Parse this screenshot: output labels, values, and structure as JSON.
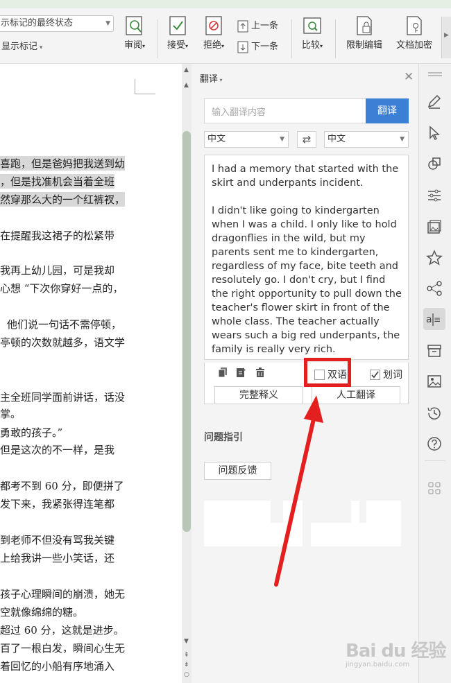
{
  "ribbon": {
    "markup_state": "示标记的最终状态",
    "show_markup": "显示标记",
    "review": "审阅",
    "accept": "接受",
    "reject": "拒绝",
    "prev": "上一条",
    "next": "下一条",
    "compare": "比较",
    "restrict_edit": "限制编辑",
    "doc_encrypt": "文档加密"
  },
  "document": {
    "lines": [
      {
        "text": "喜跑，但是爸妈把我送到幼",
        "highlight": true
      },
      {
        "text": "，但是找准机会当着全班",
        "highlight": true
      },
      {
        "text": "然穿那么大的一个红裤衩，",
        "highlight": true
      },
      {
        "text": "在提醒我这裙子的松紧带",
        "highlight": false
      },
      {
        "text": "我再上幼儿园，可是我却",
        "highlight": false
      },
      {
        "text": "心想 “下次你穿好一点的，",
        "highlight": false
      },
      {
        "text": "他们说一句话不需停顿，",
        "highlight": false
      },
      {
        "text": "亭顿的次数就越多，语文学",
        "highlight": false
      },
      {
        "text": "主全班同学面前讲话，话没",
        "highlight": false
      },
      {
        "text": "掌。",
        "highlight": false
      },
      {
        "text": "勇敢的孩子。”",
        "highlight": false
      },
      {
        "text": "但是这次的不一样，是我",
        "highlight": false
      },
      {
        "text": "都考不到 60 分，即便拼了",
        "highlight": false
      },
      {
        "text": "发下来，我紧张得连笔都",
        "highlight": false
      },
      {
        "text": "到老师不但没有骂我关键",
        "highlight": false
      },
      {
        "text": "上给我讲一些小笑话，还",
        "highlight": false
      },
      {
        "text": "孩子心理瞬间的崩溃，她无",
        "highlight": false
      },
      {
        "text": "空就像绵绵的糖。",
        "highlight": false
      },
      {
        "text": "超过 60 分，这就是进步。",
        "highlight": false
      },
      {
        "text": "百了一根白发，瞬间心生无",
        "highlight": false
      },
      {
        "text": "着回忆的小船有序地涌入",
        "highlight": false
      }
    ]
  },
  "panel": {
    "title": "翻译",
    "input_placeholder": "输入翻译内容",
    "translate_button": "翻译",
    "source_lang": "中文",
    "target_lang": "中文",
    "result_paragraphs": [
      "I had a memory that started with the skirt and underpants incident.",
      "I didn't like going to kindergarten when I was a child. I only like to hold dragonflies in the wild, but my parents sent me to kindergarten, regardless of my face, bite teeth and resolutely go. I don't cry, but I find the right opportunity to pull down the teacher's flower skirt in front of the whole class. The teacher actually wears such a big red underpants, the family is really very rich."
    ],
    "bilingual_label": "双语",
    "bilingual_checked": false,
    "word_select_label": "划词",
    "word_select_checked": true,
    "full_definition_button": "完整释义",
    "human_translation_button": "人工翻译",
    "section_title": "问题指引",
    "feedback_button": "问题反馈"
  },
  "watermark": {
    "main": "Bai du 经验",
    "sub": "jingyan.baidu.com"
  },
  "colors": {
    "accent_blue": "#3c80d6",
    "highlight_red": "#e3201f",
    "scroll_green": "#b7c6b7"
  }
}
